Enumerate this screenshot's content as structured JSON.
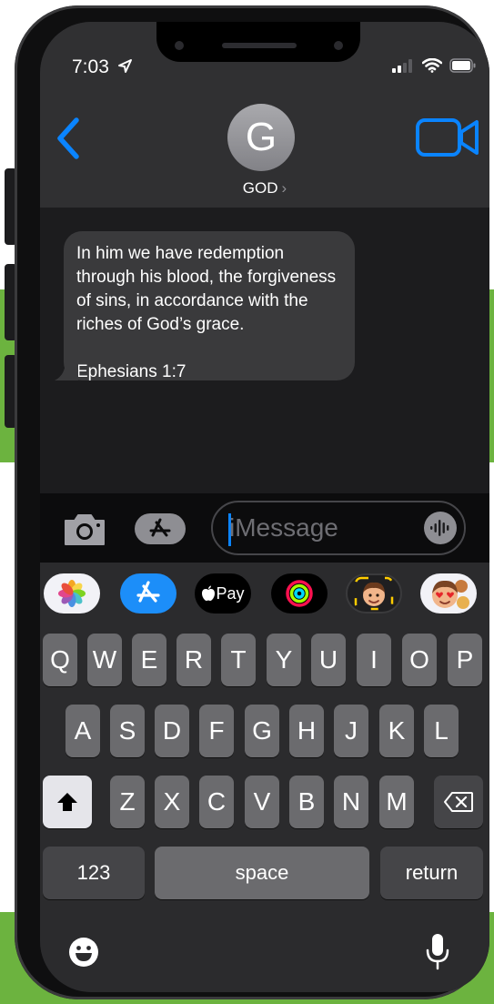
{
  "status_bar": {
    "time": "7:03"
  },
  "header": {
    "avatar_letter": "G",
    "contact_name": "GOD",
    "contact_chevron": "›",
    "back_icon": "chevron-left-icon",
    "video_icon": "video-camera-icon"
  },
  "message": {
    "lines": [
      "In him we have redemption",
      "through his blood, the forgiveness",
      "of sins, in accordance with the",
      "riches of God’s grace."
    ],
    "reference": "Ephesians 1:7"
  },
  "input_bar": {
    "placeholder": "iMessage",
    "camera_icon": "camera-icon",
    "apps_icon": "app-store-icon",
    "dictation_icon": "waveform-icon"
  },
  "app_strip": {
    "items": [
      {
        "name": "photos-app-icon"
      },
      {
        "name": "app-store-app-icon"
      },
      {
        "name": "apple-pay-app-icon",
        "label": "Pay"
      },
      {
        "name": "activity-app-icon"
      },
      {
        "name": "memoji-app-icon"
      },
      {
        "name": "memoji-stickers-app-icon"
      }
    ]
  },
  "keyboard": {
    "row1": [
      "Q",
      "W",
      "E",
      "R",
      "T",
      "Y",
      "U",
      "I",
      "O",
      "P"
    ],
    "row2": [
      "A",
      "S",
      "D",
      "F",
      "G",
      "H",
      "J",
      "K",
      "L"
    ],
    "row3": [
      "Z",
      "X",
      "C",
      "V",
      "B",
      "N",
      "M"
    ],
    "numbers_label": "123",
    "space_label": "space",
    "return_label": "return",
    "shift_icon": "shift-icon",
    "delete_icon": "delete-icon",
    "emoji_icon": "emoji-icon",
    "mic_icon": "microphone-icon"
  },
  "colors": {
    "accent": "#0a84ff",
    "background_green": "#6cb33f",
    "bubble": "#3a3a3c"
  }
}
